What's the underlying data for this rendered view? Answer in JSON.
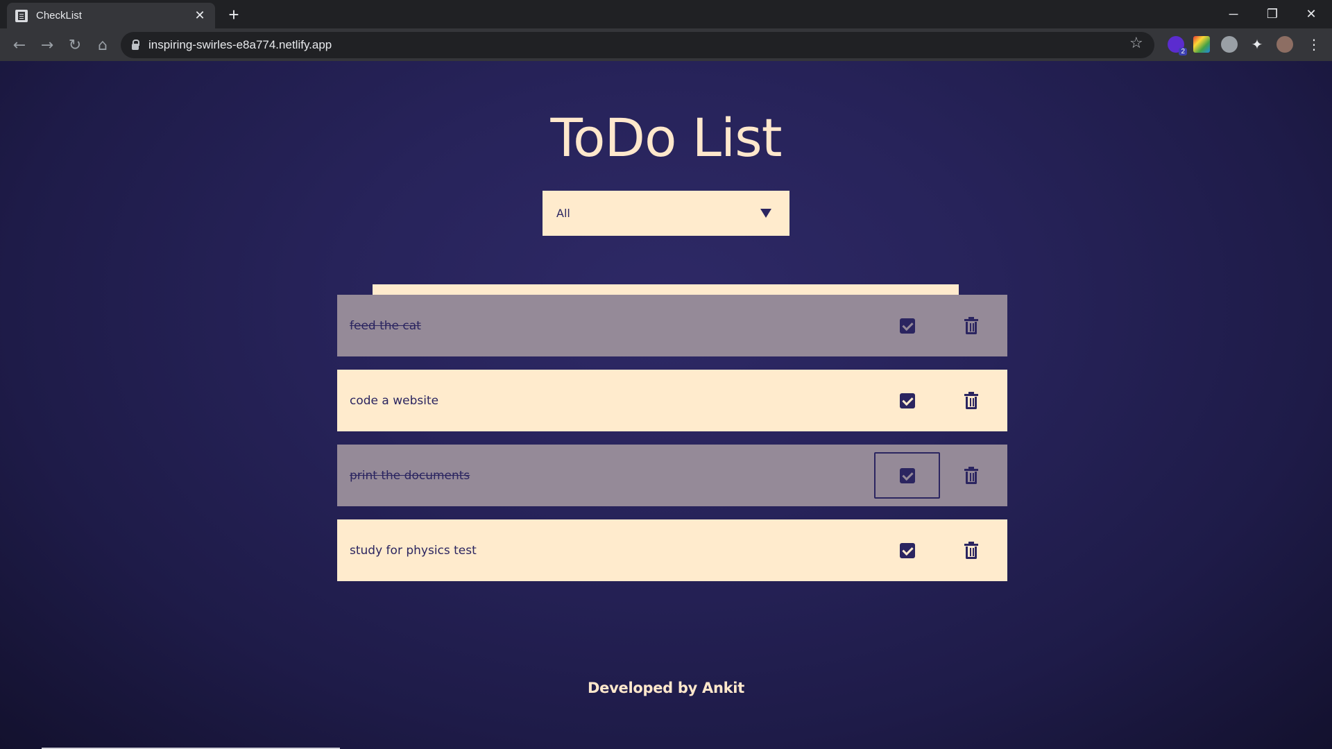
{
  "browser": {
    "tab_title": "CheckList",
    "tab_close": "✕",
    "new_tab": "+",
    "url": "inspiring-swirles-e8a774.netlify.app",
    "window_controls": {
      "minimize": "─",
      "restore": "❐",
      "close": "✕"
    },
    "nav": {
      "back": "←",
      "forward": "→",
      "reload": "↻",
      "home": "⌂"
    },
    "star": "☆",
    "extension_badge": "2"
  },
  "app": {
    "title": "ToDo List",
    "filter": {
      "selected": "All"
    },
    "add_input": {
      "value": "",
      "placeholder": ""
    },
    "todos": [
      {
        "text": "feed the cat",
        "completed": true
      },
      {
        "text": "code a website",
        "completed": false
      },
      {
        "text": "print the documents",
        "completed": true
      },
      {
        "text": "study for physics test",
        "completed": false
      }
    ],
    "footer": "Developed by Ankit"
  },
  "colors": {
    "accent": "#2b2560",
    "cream": "#ffebcd",
    "completed_bg": "#958a98",
    "heading": "#ffe8cc"
  }
}
